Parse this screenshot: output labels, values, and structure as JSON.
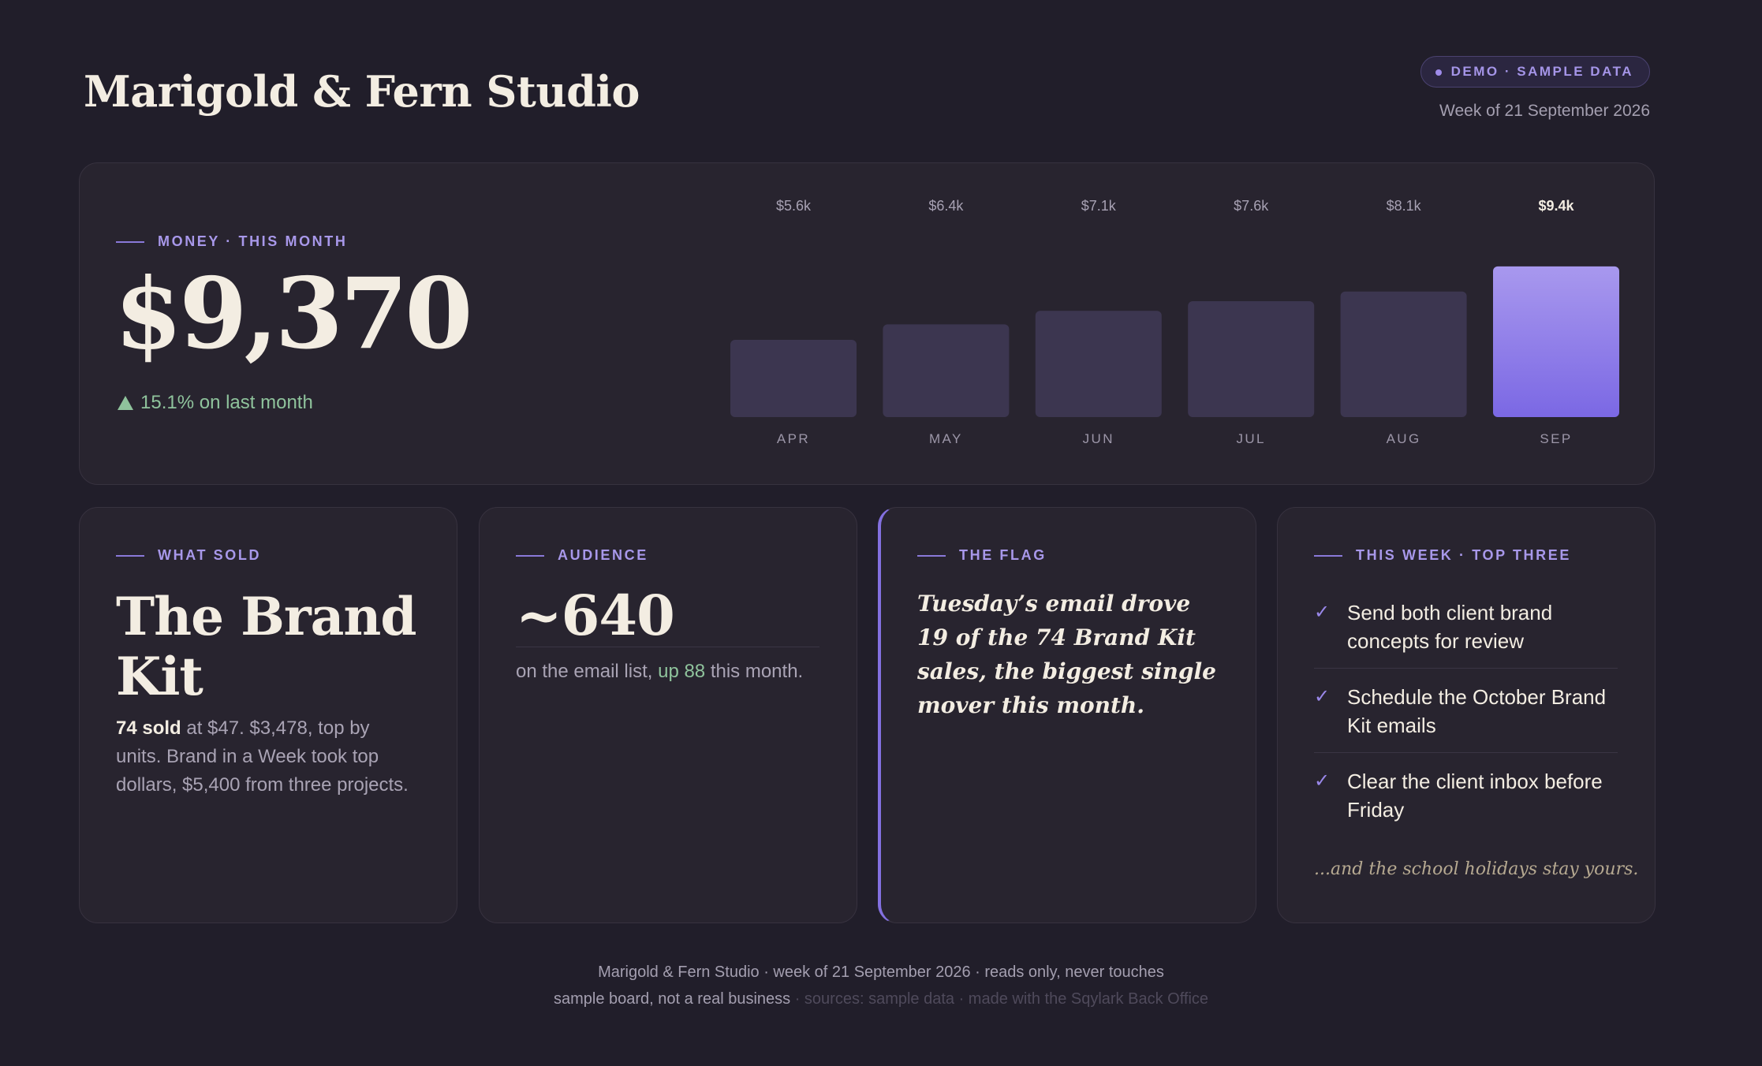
{
  "header": {
    "title": "Marigold & Fern Studio",
    "badge": "DEMO · SAMPLE DATA",
    "week": "Week of 21 September 2026"
  },
  "money": {
    "eyebrow": "MONEY · THIS MONTH",
    "amount": "$9,370",
    "delta": "15.1% on last month"
  },
  "chart_data": {
    "type": "bar",
    "categories": [
      "APR",
      "MAY",
      "JUN",
      "JUL",
      "AUG",
      "SEP"
    ],
    "values": [
      5.6,
      6.4,
      7.1,
      7.6,
      8.1,
      9.4
    ],
    "value_labels": [
      "$5.6k",
      "$6.4k",
      "$7.1k",
      "$7.6k",
      "$8.1k",
      "$9.4k"
    ],
    "ylabel": "",
    "highlight_index": 5,
    "colors": {
      "bar": "#3c3650",
      "highlight_top": "#a898ee",
      "highlight_bottom": "#7b68e4"
    }
  },
  "sold": {
    "eyebrow": "WHAT SOLD",
    "title": "The Brand Kit",
    "bold": "74 sold",
    "rest": " at $47. $3,478, top by units. Brand in a Week took top dollars, $5,400 from three projects."
  },
  "audience": {
    "eyebrow": "AUDIENCE",
    "number": "~640",
    "pre": "on the email list, ",
    "up": "up 88",
    "post": " this month."
  },
  "flag": {
    "eyebrow": "THE FLAG",
    "quote": "Tuesday’s email drove 19 of the 74 Brand Kit sales, the biggest single mover this month."
  },
  "todo": {
    "eyebrow": "THIS WEEK · TOP THREE",
    "items": [
      "Send both client brand concepts for review",
      "Schedule the October Brand Kit emails",
      "Clear the client inbox before Friday"
    ],
    "footer": "...and the school holidays stay yours."
  },
  "footer": {
    "line1": "Marigold & Fern Studio · week of 21 September 2026 · reads only, never touches",
    "line2": "sample board, not a real business",
    "line2_dim": " · sources: sample data · made with the Sqylark Back Office"
  },
  "colors": {
    "background": "#211e2a",
    "card": "#28242f",
    "accent": "#8a79d9",
    "positive": "#8fc39c"
  }
}
